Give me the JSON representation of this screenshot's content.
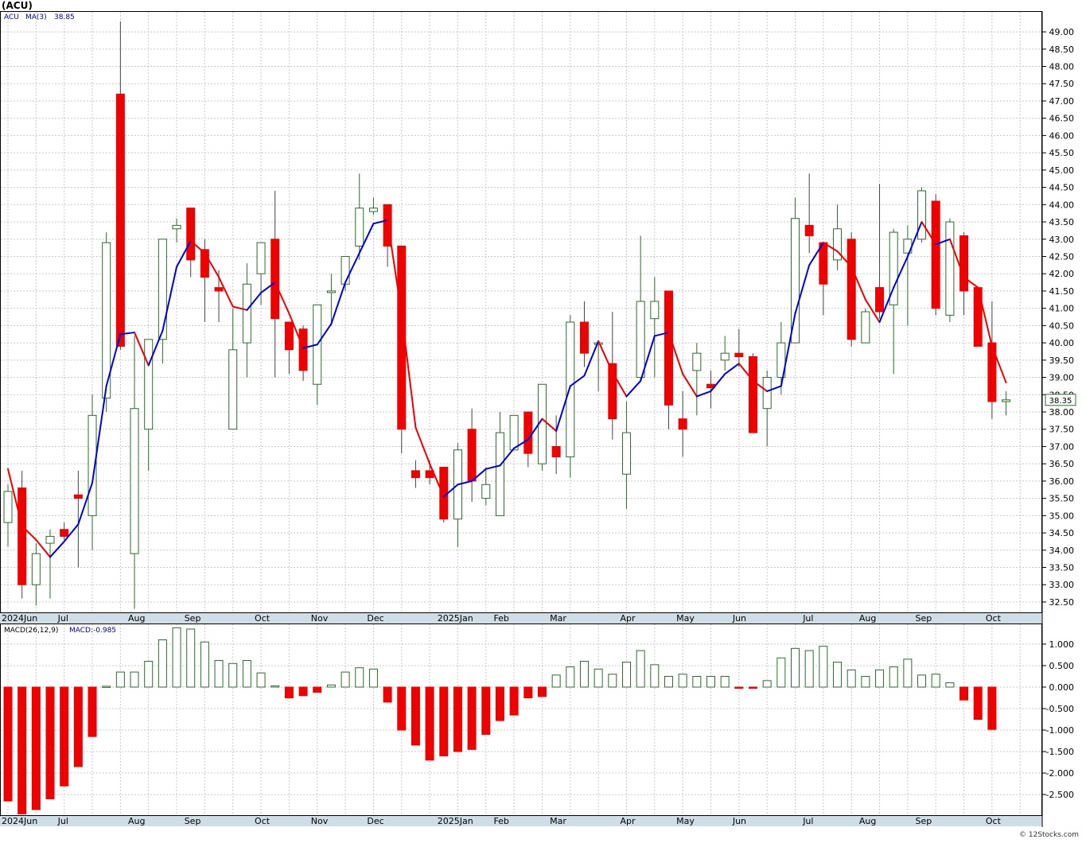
{
  "header": {
    "title": "(ACU)"
  },
  "price_panel": {
    "symbol_label": "ACU",
    "ma_label": "MA(3)",
    "ma_value": "38.85",
    "last_price_label": "38.35"
  },
  "macd_panel": {
    "label": "MACD(26,12,9)",
    "value_label": "MACD:-0.985"
  },
  "footer": {
    "watermark": "© 12Stocks.com"
  },
  "colors": {
    "up_candle": "#2f6b2f",
    "down_candle": "#ee0000",
    "ma_up": "#0000dd",
    "ma_down": "#ee0000",
    "grid": "#c8c8c8",
    "axis_bar": "#cfdde6"
  },
  "chart_data": [
    {
      "type": "candlestick",
      "series_name": "ACU",
      "ylim": [
        32.2,
        49.6
      ],
      "y_ticks": [
        "32.50",
        "33.00",
        "33.50",
        "34.00",
        "34.50",
        "35.00",
        "35.50",
        "36.00",
        "36.50",
        "37.00",
        "37.50",
        "38.00",
        "38.50",
        "39.00",
        "39.50",
        "40.00",
        "40.50",
        "41.00",
        "41.50",
        "42.00",
        "42.50",
        "43.00",
        "43.50",
        "44.00",
        "44.50",
        "45.00",
        "45.50",
        "46.00",
        "46.50",
        "47.00",
        "47.50",
        "48.00",
        "48.50",
        "49.00"
      ],
      "x_labels": [
        {
          "label": "2024Jun",
          "index": 0
        },
        {
          "label": "Jul",
          "index": 4
        },
        {
          "label": "Aug",
          "index": 9
        },
        {
          "label": "Sep",
          "index": 13
        },
        {
          "label": "Oct",
          "index": 18
        },
        {
          "label": "Nov",
          "index": 22
        },
        {
          "label": "Dec",
          "index": 26
        },
        {
          "label": "2025Jan",
          "index": 31
        },
        {
          "label": "Feb",
          "index": 35
        },
        {
          "label": "Mar",
          "index": 39
        },
        {
          "label": "Apr",
          "index": 44
        },
        {
          "label": "May",
          "index": 48
        },
        {
          "label": "Jun",
          "index": 52
        },
        {
          "label": "Jul",
          "index": 57
        },
        {
          "label": "Aug",
          "index": 61
        },
        {
          "label": "Sep",
          "index": 65
        },
        {
          "label": "Oct",
          "index": 70
        }
      ],
      "candles": [
        {
          "o": 34.8,
          "h": 35.9,
          "l": 34.1,
          "c": 35.7
        },
        {
          "o": 35.8,
          "h": 36.3,
          "l": 32.6,
          "c": 33.0
        },
        {
          "o": 33.0,
          "h": 34.2,
          "l": 32.4,
          "c": 33.9
        },
        {
          "o": 34.2,
          "h": 34.6,
          "l": 32.6,
          "c": 34.4
        },
        {
          "o": 34.6,
          "h": 34.8,
          "l": 34.3,
          "c": 34.4
        },
        {
          "o": 35.6,
          "h": 36.3,
          "l": 33.5,
          "c": 35.5
        },
        {
          "o": 35.0,
          "h": 38.5,
          "l": 34.0,
          "c": 37.9
        },
        {
          "o": 38.4,
          "h": 43.2,
          "l": 38.0,
          "c": 42.9
        },
        {
          "o": 47.2,
          "h": 49.3,
          "l": 39.8,
          "c": 39.9
        },
        {
          "o": 33.9,
          "h": 40.2,
          "l": 32.3,
          "c": 38.1
        },
        {
          "o": 37.5,
          "h": 39.5,
          "l": 36.3,
          "c": 40.1
        },
        {
          "o": 40.1,
          "h": 43.0,
          "l": 39.4,
          "c": 43.0
        },
        {
          "o": 43.3,
          "h": 43.6,
          "l": 42.9,
          "c": 43.4
        },
        {
          "o": 43.9,
          "h": 43.9,
          "l": 41.9,
          "c": 42.4
        },
        {
          "o": 42.7,
          "h": 43.0,
          "l": 40.6,
          "c": 41.9
        },
        {
          "o": 41.6,
          "h": 42.1,
          "l": 40.6,
          "c": 41.5
        },
        {
          "o": 37.5,
          "h": 41.0,
          "l": 37.5,
          "c": 39.8
        },
        {
          "o": 40.0,
          "h": 42.3,
          "l": 39.0,
          "c": 41.7
        },
        {
          "o": 42.0,
          "h": 42.9,
          "l": 41.1,
          "c": 42.9
        },
        {
          "o": 43.0,
          "h": 44.4,
          "l": 39.0,
          "c": 40.7
        },
        {
          "o": 40.6,
          "h": 40.6,
          "l": 39.1,
          "c": 39.8
        },
        {
          "o": 40.4,
          "h": 40.5,
          "l": 38.9,
          "c": 39.2
        },
        {
          "o": 38.8,
          "h": 41.0,
          "l": 38.2,
          "c": 41.1
        },
        {
          "o": 41.5,
          "h": 42.0,
          "l": 40.5,
          "c": 41.5
        },
        {
          "o": 41.7,
          "h": 42.5,
          "l": 41.5,
          "c": 42.5
        },
        {
          "o": 42.8,
          "h": 44.9,
          "l": 42.4,
          "c": 43.9
        },
        {
          "o": 43.8,
          "h": 44.2,
          "l": 43.7,
          "c": 43.9
        },
        {
          "o": 44.0,
          "h": 44.0,
          "l": 42.2,
          "c": 42.8
        },
        {
          "o": 42.8,
          "h": 42.8,
          "l": 36.8,
          "c": 37.5
        },
        {
          "o": 36.3,
          "h": 36.6,
          "l": 35.8,
          "c": 36.1
        },
        {
          "o": 36.3,
          "h": 36.6,
          "l": 35.9,
          "c": 36.1
        },
        {
          "o": 36.4,
          "h": 36.4,
          "l": 34.8,
          "c": 34.9
        },
        {
          "o": 34.9,
          "h": 37.1,
          "l": 34.1,
          "c": 36.9
        },
        {
          "o": 37.5,
          "h": 38.1,
          "l": 35.4,
          "c": 36.0
        },
        {
          "o": 35.5,
          "h": 36.4,
          "l": 35.3,
          "c": 35.9
        },
        {
          "o": 35.0,
          "h": 38.0,
          "l": 35.0,
          "c": 37.4
        },
        {
          "o": 36.9,
          "h": 37.9,
          "l": 36.9,
          "c": 37.9
        },
        {
          "o": 38.0,
          "h": 38.0,
          "l": 36.4,
          "c": 36.8
        },
        {
          "o": 36.5,
          "h": 38.8,
          "l": 36.3,
          "c": 38.8
        },
        {
          "o": 37.0,
          "h": 37.9,
          "l": 36.2,
          "c": 36.7
        },
        {
          "o": 36.7,
          "h": 40.8,
          "l": 36.1,
          "c": 40.6
        },
        {
          "o": 40.6,
          "h": 41.2,
          "l": 39.3,
          "c": 39.7
        },
        {
          "o": 40.0,
          "h": 40.0,
          "l": 38.6,
          "c": 40.0
        },
        {
          "o": 39.4,
          "h": 40.9,
          "l": 37.2,
          "c": 37.8
        },
        {
          "o": 36.2,
          "h": 38.3,
          "l": 35.2,
          "c": 37.4
        },
        {
          "o": 39.0,
          "h": 43.1,
          "l": 38.9,
          "c": 41.2
        },
        {
          "o": 40.7,
          "h": 41.9,
          "l": 39.0,
          "c": 41.2
        },
        {
          "o": 41.5,
          "h": 41.5,
          "l": 37.5,
          "c": 38.2
        },
        {
          "o": 37.8,
          "h": 38.6,
          "l": 36.7,
          "c": 37.5
        },
        {
          "o": 39.2,
          "h": 40.0,
          "l": 37.9,
          "c": 39.7
        },
        {
          "o": 38.8,
          "h": 39.2,
          "l": 38.1,
          "c": 38.7
        },
        {
          "o": 39.5,
          "h": 40.2,
          "l": 39.2,
          "c": 39.7
        },
        {
          "o": 39.7,
          "h": 40.4,
          "l": 39.3,
          "c": 39.6
        },
        {
          "o": 39.6,
          "h": 39.7,
          "l": 37.4,
          "c": 37.4
        },
        {
          "o": 38.1,
          "h": 39.2,
          "l": 37.0,
          "c": 39.0
        },
        {
          "o": 39.0,
          "h": 40.6,
          "l": 38.5,
          "c": 40.0
        },
        {
          "o": 40.0,
          "h": 44.2,
          "l": 40.0,
          "c": 43.6
        },
        {
          "o": 43.4,
          "h": 44.9,
          "l": 42.6,
          "c": 43.1
        },
        {
          "o": 42.9,
          "h": 42.9,
          "l": 40.8,
          "c": 41.7
        },
        {
          "o": 42.4,
          "h": 44.0,
          "l": 42.1,
          "c": 43.3
        },
        {
          "o": 43.0,
          "h": 43.2,
          "l": 39.9,
          "c": 40.1
        },
        {
          "o": 40.0,
          "h": 41.0,
          "l": 40.0,
          "c": 40.9
        },
        {
          "o": 41.6,
          "h": 44.6,
          "l": 40.7,
          "c": 40.9
        },
        {
          "o": 41.1,
          "h": 43.3,
          "l": 39.1,
          "c": 43.2
        },
        {
          "o": 42.6,
          "h": 43.4,
          "l": 40.5,
          "c": 43.0
        },
        {
          "o": 43.0,
          "h": 44.5,
          "l": 42.9,
          "c": 44.4
        },
        {
          "o": 44.1,
          "h": 44.3,
          "l": 40.8,
          "c": 41.0
        },
        {
          "o": 40.8,
          "h": 43.6,
          "l": 40.6,
          "c": 43.5
        },
        {
          "o": 43.1,
          "h": 43.2,
          "l": 40.8,
          "c": 41.5
        },
        {
          "o": 41.6,
          "h": 41.6,
          "l": 39.9,
          "c": 39.9
        },
        {
          "o": 40.0,
          "h": 41.2,
          "l": 37.8,
          "c": 38.3
        },
        {
          "o": 38.3,
          "h": 38.6,
          "l": 37.9,
          "c": 38.35
        }
      ],
      "ma": [
        36.35,
        34.7,
        34.3,
        33.8,
        34.25,
        34.75,
        35.95,
        38.75,
        40.25,
        40.3,
        39.35,
        40.35,
        42.2,
        42.95,
        42.6,
        41.9,
        41.05,
        40.95,
        41.45,
        41.75,
        40.85,
        39.85,
        39.95,
        40.55,
        41.75,
        42.6,
        43.45,
        43.55,
        40.85,
        37.55,
        36.5,
        35.55,
        35.9,
        36.0,
        36.35,
        36.45,
        36.95,
        37.2,
        37.8,
        37.45,
        38.75,
        39.05,
        40.05,
        39.15,
        38.45,
        38.9,
        40.2,
        40.3,
        39.1,
        38.45,
        38.6,
        39.1,
        39.4,
        38.9,
        38.6,
        38.75,
        40.85,
        42.25,
        42.9,
        42.65,
        42.2,
        41.25,
        40.6,
        41.6,
        42.5,
        43.5,
        42.85,
        43.0,
        41.9,
        41.6,
        39.9,
        38.85
      ]
    },
    {
      "type": "bar",
      "series_name": "MACD",
      "ylim": [
        -2.98,
        1.48
      ],
      "y_ticks": [
        "-2.500",
        "-2.000",
        "-1.500",
        "-1.000",
        "-0.500",
        "0.000",
        "0.500",
        "1.000"
      ],
      "values": [
        -2.65,
        -2.95,
        -2.85,
        -2.6,
        -2.3,
        -1.85,
        -1.15,
        0.02,
        0.35,
        0.35,
        0.6,
        1.1,
        1.38,
        1.35,
        1.05,
        0.62,
        0.55,
        0.62,
        0.33,
        0.03,
        -0.25,
        -0.2,
        -0.12,
        0.05,
        0.35,
        0.45,
        0.42,
        -0.35,
        -1.0,
        -1.35,
        -1.7,
        -1.6,
        -1.5,
        -1.45,
        -1.1,
        -0.78,
        -0.65,
        -0.25,
        -0.22,
        0.28,
        0.47,
        0.6,
        0.42,
        0.3,
        0.58,
        0.85,
        0.52,
        0.25,
        0.3,
        0.25,
        0.25,
        0.25,
        -0.02,
        -0.02,
        0.15,
        0.68,
        0.9,
        0.85,
        0.95,
        0.58,
        0.4,
        0.25,
        0.4,
        0.47,
        0.65,
        0.28,
        0.3,
        0.1,
        -0.3,
        -0.75,
        -0.985
      ]
    }
  ]
}
